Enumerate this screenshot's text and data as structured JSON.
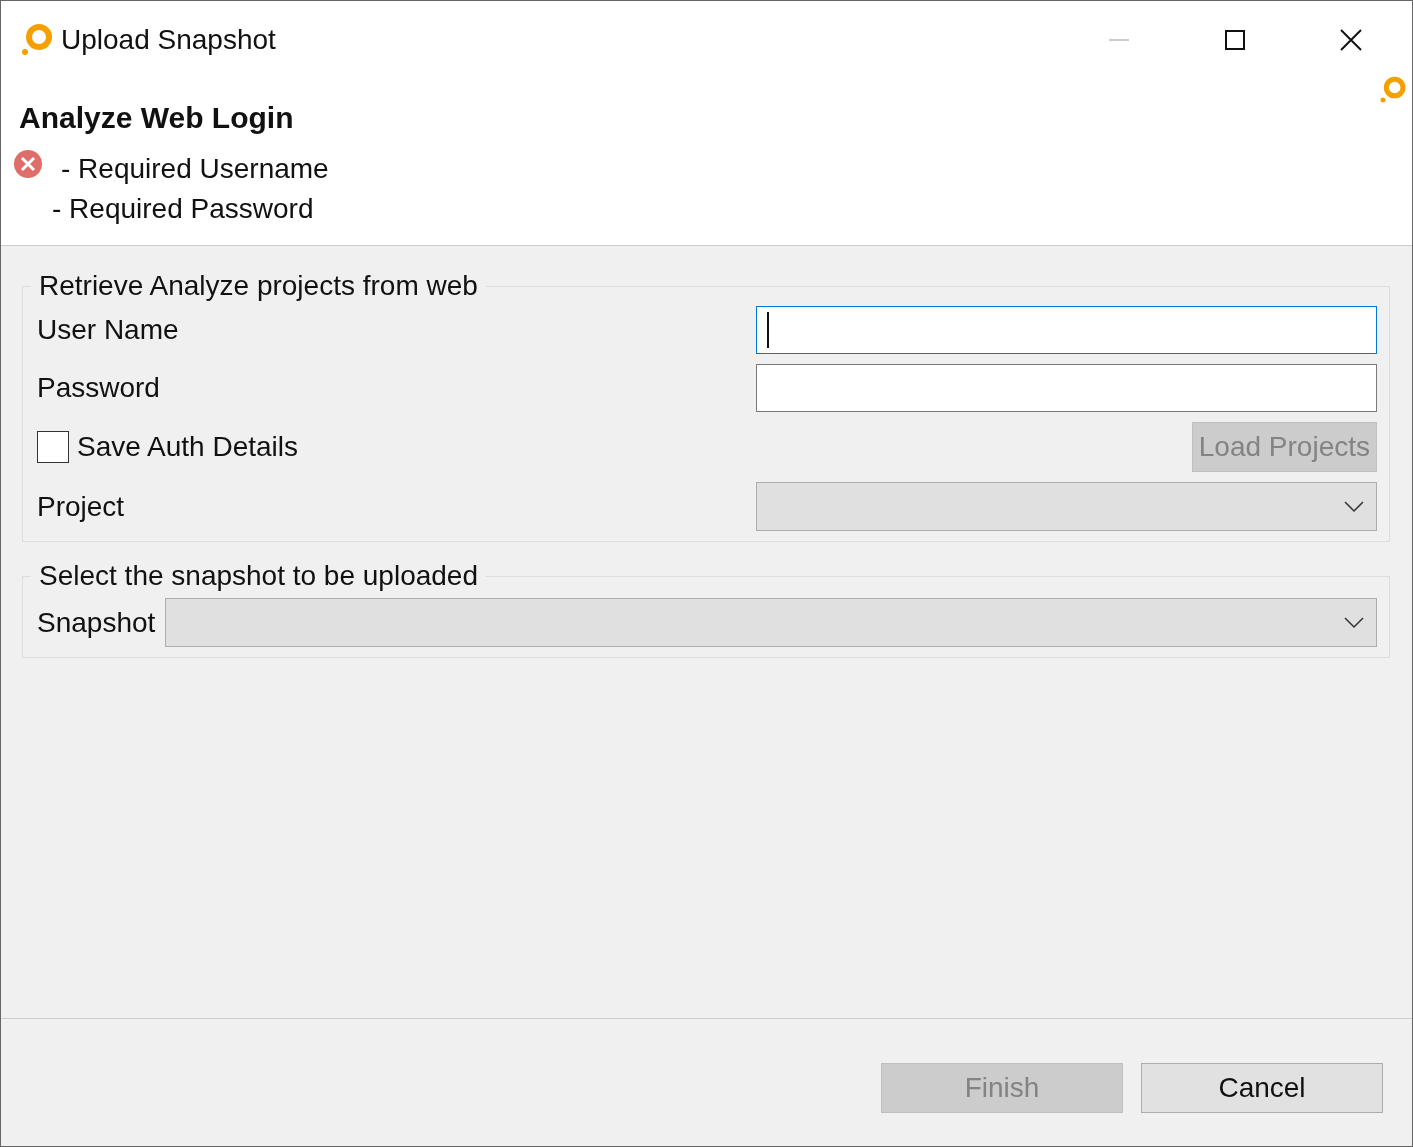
{
  "window": {
    "title": "Upload Snapshot"
  },
  "header": {
    "title": "Analyze Web Login",
    "messages": [
      "- Required Username",
      "- Required Password"
    ]
  },
  "login_group": {
    "title": "Retrieve Analyze projects from web",
    "fields": [
      {
        "label": "User Name",
        "focused": true
      },
      {
        "label": "Password",
        "focused": false
      }
    ],
    "save_auth": {
      "label": "Save Auth Details",
      "checked": false
    },
    "load_button": {
      "label": "Load Projects",
      "disabled": true
    },
    "project": {
      "label": "Project",
      "disabled": true
    }
  },
  "snapshot_group": {
    "title": "Select the snapshot to be uploaded",
    "snapshot": {
      "label": "Snapshot",
      "disabled": true
    }
  },
  "buttons": [
    {
      "label": "Finish",
      "disabled": true
    },
    {
      "label": "Cancel",
      "disabled": false
    }
  ]
}
